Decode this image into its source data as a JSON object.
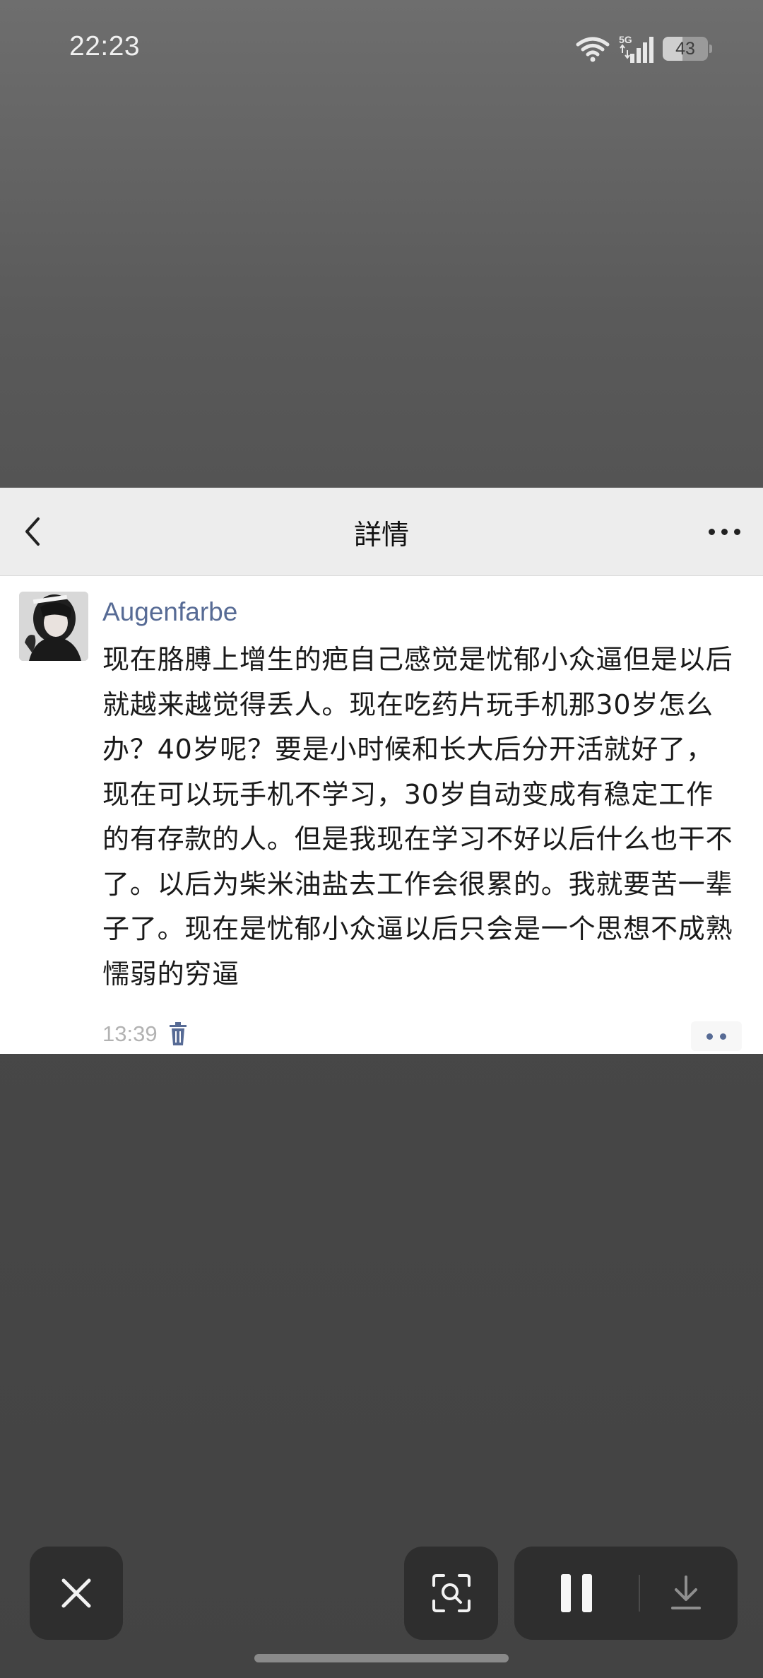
{
  "status_bar": {
    "time": "22:23",
    "network": "5G",
    "battery_level": "43",
    "battery_fraction": 0.43
  },
  "header": {
    "title": "詳情"
  },
  "post": {
    "author": "Augenfarbe",
    "text": "现在胳膊上增生的疤自己感觉是忧郁小众逼但是以后就越来越觉得丢人。现在吃药片玩手机那30岁怎么办？40岁呢？要是小时候和长大后分开活就好了，现在可以玩手机不学习，30岁自动变成有稳定工作的有存款的人。但是我现在学习不好以后什么也干不了。以后为柴米油盐去工作会很累的。我就要苦一辈子了。现在是忧郁小众逼以后只会是一个思想不成熟懦弱的穷逼",
    "time": "13:39"
  },
  "icons": {
    "back": "chevron-left-icon",
    "more": "more-dots-icon",
    "delete": "trash-icon",
    "comment": "comment-dots-icon",
    "close": "close-icon",
    "scan": "scan-search-icon",
    "pause": "pause-icon",
    "download": "download-icon"
  },
  "colors": {
    "link_blue": "#576b95",
    "header_bg": "#ededed",
    "toolbar_bg": "#2e2e2e"
  }
}
